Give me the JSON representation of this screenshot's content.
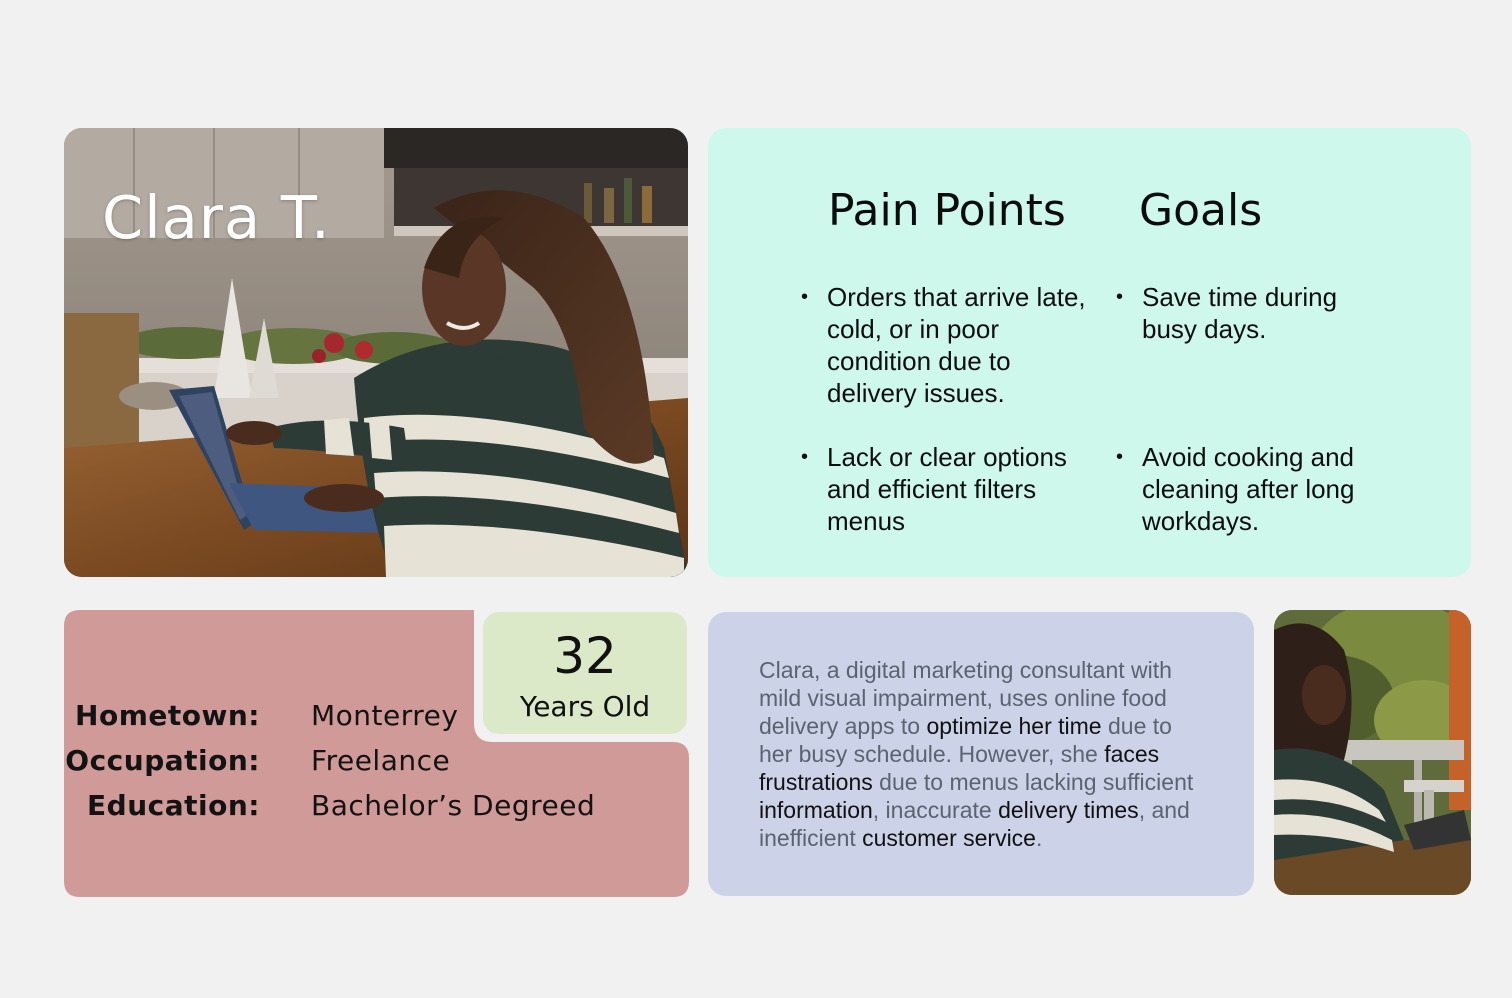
{
  "persona": {
    "name": "Clara T.",
    "age_number": "32",
    "age_label": "Years Old"
  },
  "demographics": {
    "hometown_label": "Hometown:",
    "hometown_value": "Monterrey",
    "occupation_label": "Occupation:",
    "occupation_value": "Freelance",
    "education_label": "Education:",
    "education_value": "Bachelor’s Degreed"
  },
  "pain_points": {
    "title": "Pain Points",
    "items": [
      "Orders that arrive late, cold, or in poor condition due to delivery issues.",
      "Lack or clear options and efficient filters menus"
    ]
  },
  "goals": {
    "title": "Goals",
    "items": [
      "Save time during busy days.",
      "Avoid cooking and cleaning after long workdays."
    ]
  },
  "bio": {
    "p1": "Clara, a digital marketing consultant with mild visual impairment, uses online food delivery apps to ",
    "e1": "optimize her time",
    "p2": " due to her busy schedule. However, she ",
    "e2": "faces frustrations",
    "p3": " due to menus lacking sufficient ",
    "e3": "information",
    "p4": ", inaccurate ",
    "e4": "delivery times",
    "p5": ", and inefficient ",
    "e5": "customer service",
    "p6": "."
  },
  "colors": {
    "page_bg": "#f1f1f1",
    "needs_card": "#cff8ec",
    "demographics_card": "#d09a99",
    "age_card": "#dbe9c9",
    "bio_card": "#ccd2e8"
  }
}
